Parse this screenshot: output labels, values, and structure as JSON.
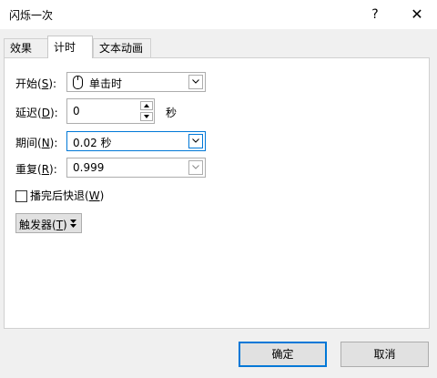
{
  "window": {
    "title": "闪烁一次",
    "help": "?",
    "close": "✕"
  },
  "tabs": [
    {
      "label": "效果"
    },
    {
      "label": "计时",
      "active": true
    },
    {
      "label": "文本动画"
    }
  ],
  "timing": {
    "start": {
      "label": "开始(",
      "accel": "S",
      "suffix": "):",
      "value": "单击时"
    },
    "delay": {
      "label": "延迟(",
      "accel": "D",
      "suffix": "):",
      "value": "0",
      "unit": "秒"
    },
    "duration": {
      "label": "期间(",
      "accel": "N",
      "suffix": "):",
      "value": "0.02 秒"
    },
    "repeat": {
      "label": "重复(",
      "accel": "R",
      "suffix": "):",
      "value": "0.999"
    },
    "rewind": {
      "label": "播完后快退(",
      "accel": "W",
      "suffix": ")",
      "checked": false
    },
    "trigger": {
      "label": "触发器(",
      "accel": "T",
      "suffix": ")"
    }
  },
  "buttons": {
    "ok": "确定",
    "cancel": "取消"
  }
}
